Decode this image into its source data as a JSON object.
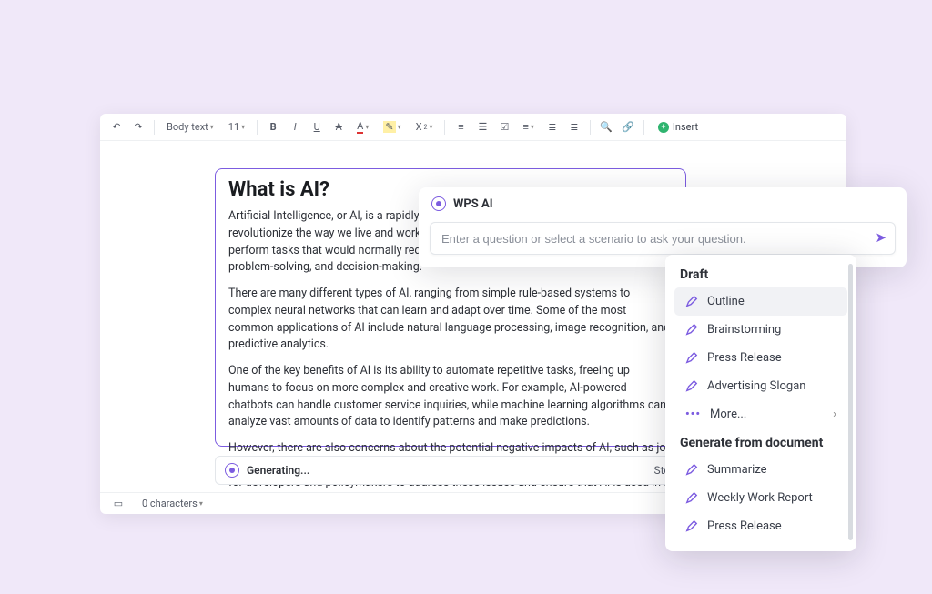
{
  "toolbar": {
    "style_label": "Body text",
    "font_size": "11",
    "insert_label": "Insert"
  },
  "document": {
    "title": "What is AI?",
    "paragraphs": [
      "Artificial Intelligence, or AI, is a rapidly growing field that has the potential to revolutionize the way we live and work. At its core, AI refers to the ability of machines to perform tasks that would normally require human intelligence, such as learning, problem-solving, and decision-making.",
      "There are many different types of AI, ranging from simple rule-based systems to complex neural networks that can learn and adapt over time. Some of the most common applications of AI include natural language processing, image recognition, and predictive analytics.",
      "One of the key benefits of AI is its ability to automate repetitive tasks, freeing up humans to focus on more complex and creative work. For example, AI-powered chatbots can handle customer service inquiries, while machine learning algorithms can analyze vast amounts of data to identify patterns and make predictions.",
      "However, there are also concerns about the potential negative impacts of AI, such as job displacement and the potential for bias in decision-making algorithms. It is important for developers and policymakers to address these issues and ensure that AI is used in a responsible"
    ]
  },
  "generating": {
    "label": "Generating...",
    "stop": "Stop"
  },
  "status": {
    "characters": "0 characters"
  },
  "ai_panel": {
    "title": "WPS AI",
    "placeholder": "Enter a question or select a scenario to ask your question."
  },
  "ai_menu": {
    "section1": "Draft",
    "items1": [
      "Outline",
      "Brainstorming",
      "Press Release",
      "Advertising Slogan"
    ],
    "more": "More...",
    "section2": "Generate from document",
    "items2": [
      "Summarize",
      "Weekly Work Report",
      "Press Release"
    ]
  }
}
